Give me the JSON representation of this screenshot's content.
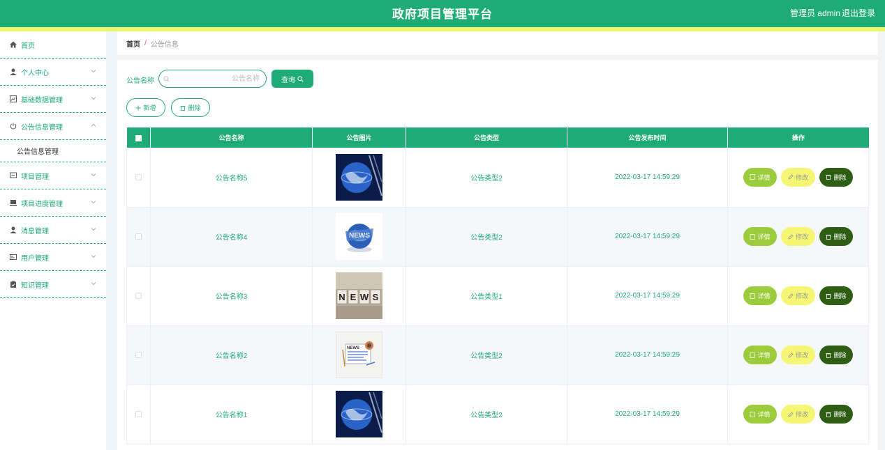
{
  "header": {
    "title": "政府项目管理平台",
    "user": "管理员 admin",
    "logout": "退出登录"
  },
  "sidebar": {
    "items": [
      {
        "label": "首页",
        "icon": "home-icon",
        "expandable": false
      },
      {
        "label": "个人中心",
        "icon": "user-icon",
        "expandable": true
      },
      {
        "label": "基础数据管理",
        "icon": "chart-icon",
        "expandable": true
      },
      {
        "label": "公告信息管理",
        "icon": "power-icon",
        "expandable": true,
        "open": true
      },
      {
        "label": "项目管理",
        "icon": "chat-icon",
        "expandable": true
      },
      {
        "label": "项目进度管理",
        "icon": "monitor-icon",
        "expandable": true
      },
      {
        "label": "消息管理",
        "icon": "user-icon",
        "expandable": true
      },
      {
        "label": "用户管理",
        "icon": "card-icon",
        "expandable": true
      },
      {
        "label": "知识管理",
        "icon": "clipboard-icon",
        "expandable": true
      }
    ],
    "submenu": {
      "label": "公告信息管理"
    }
  },
  "breadcrumb": {
    "home": "首页",
    "separator": "/",
    "current": "公告信息"
  },
  "search": {
    "label": "公告名称",
    "placeholder": "公告名称",
    "query_label": "查询"
  },
  "actions": {
    "add_label": "新增",
    "delete_label": "删除"
  },
  "table": {
    "columns": [
      "公告名称",
      "公告图片",
      "公告类型",
      "公告发布时间",
      "操作"
    ],
    "rows": [
      {
        "name": "公告名称5",
        "image": "globe",
        "type": "公告类型2",
        "time": "2022-03-17 14:59:29"
      },
      {
        "name": "公告名称4",
        "image": "news-globe",
        "type": "公告类型2",
        "time": "2022-03-17 14:59:29"
      },
      {
        "name": "公告名称3",
        "image": "news-blocks",
        "type": "公告类型1",
        "time": "2022-03-17 14:59:29"
      },
      {
        "name": "公告名称2",
        "image": "newspaper",
        "type": "公告类型2",
        "time": "2022-03-17 14:59:29"
      },
      {
        "name": "公告名称1",
        "image": "globe",
        "type": "公告类型2",
        "time": "2022-03-17 14:59:29"
      }
    ],
    "ops": {
      "detail": "详情",
      "edit": "修改",
      "delete": "删除"
    }
  },
  "colors": {
    "primary": "#1fab77",
    "strip": "#eef86a",
    "detail": "#9bcc3b",
    "edit": "#f5f774",
    "delete": "#2e5e14"
  }
}
